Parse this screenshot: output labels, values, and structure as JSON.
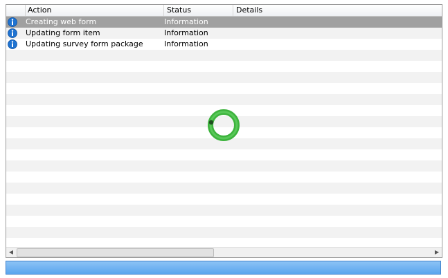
{
  "log_table": {
    "columns": [
      {
        "label": "Action"
      },
      {
        "label": "Status"
      },
      {
        "label": "Details"
      }
    ],
    "rows": [
      {
        "action": "Creating web form",
        "status": "Information",
        "details": "",
        "icon": "info-icon",
        "selected": true
      },
      {
        "action": "Updating form item",
        "status": "Information",
        "details": "",
        "icon": "info-icon",
        "selected": false
      },
      {
        "action": "Updating survey form package",
        "status": "Information",
        "details": "",
        "icon": "info-icon",
        "selected": false
      }
    ]
  },
  "colors": {
    "selected_row": "#a0a0a0",
    "info_icon": "#1f73d1",
    "spinner_green": "#3db33d",
    "progress_blue": "#5aa5ee"
  },
  "spinner": {
    "icon": "loading-spinner-icon"
  },
  "progress": {
    "fill_fraction": 1.0
  }
}
